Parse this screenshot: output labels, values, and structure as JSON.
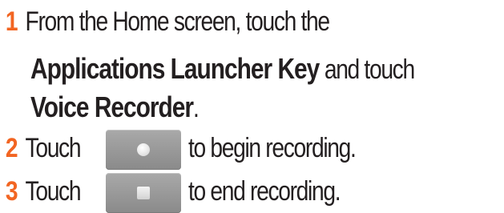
{
  "step1": {
    "number": "1",
    "line1": "From the Home screen, touch the",
    "bold_launcher": "Applications Launcher Key",
    "and_touch": " and touch",
    "bold_recorder": "Voice Recorder",
    "period": "."
  },
  "step2": {
    "number": "2",
    "touch": "Touch",
    "icon": "record-button-icon",
    "rest": "to begin recording."
  },
  "step3": {
    "number": "3",
    "touch": "Touch",
    "icon": "stop-button-icon",
    "rest": "to end recording."
  },
  "colors": {
    "step_number": "#f26522",
    "text": "#231f20"
  }
}
